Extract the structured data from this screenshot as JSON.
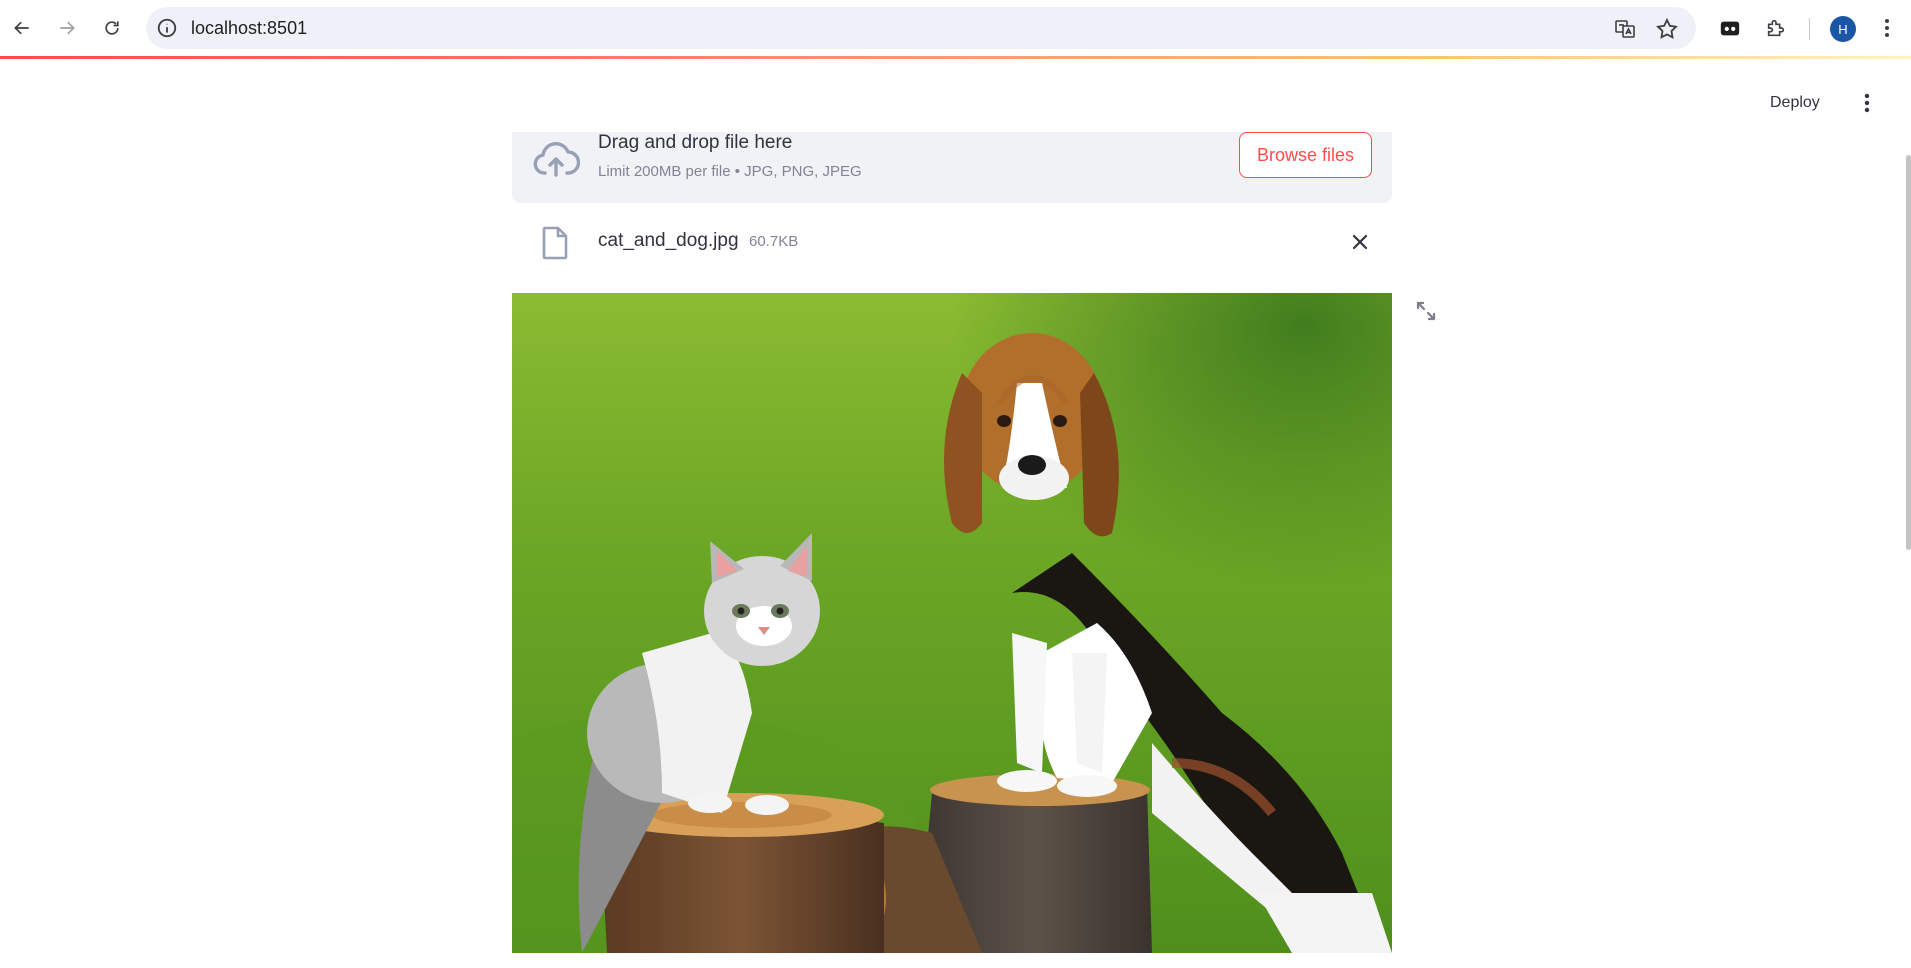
{
  "browser": {
    "url": "localhost:8501",
    "avatar_initial": "H",
    "icons": [
      "back-icon",
      "forward-icon",
      "reload-icon",
      "site-info-icon",
      "translate-icon",
      "bookmark-star-icon",
      "tab-search-icon",
      "extensions-icon",
      "menu-icon"
    ]
  },
  "header": {
    "deploy_label": "Deploy"
  },
  "uploader": {
    "title": "Drag and drop file here",
    "subtitle": "Limit 200MB per file • JPG, PNG, JPEG",
    "browse_label": "Browse files"
  },
  "uploaded_file": {
    "name": "cat_and_dog.jpg",
    "size": "60.7KB"
  },
  "colors": {
    "accent": "#ff4b4b",
    "dropzone_bg": "#f0f2f6",
    "text": "#31333f",
    "muted": "#808495"
  }
}
